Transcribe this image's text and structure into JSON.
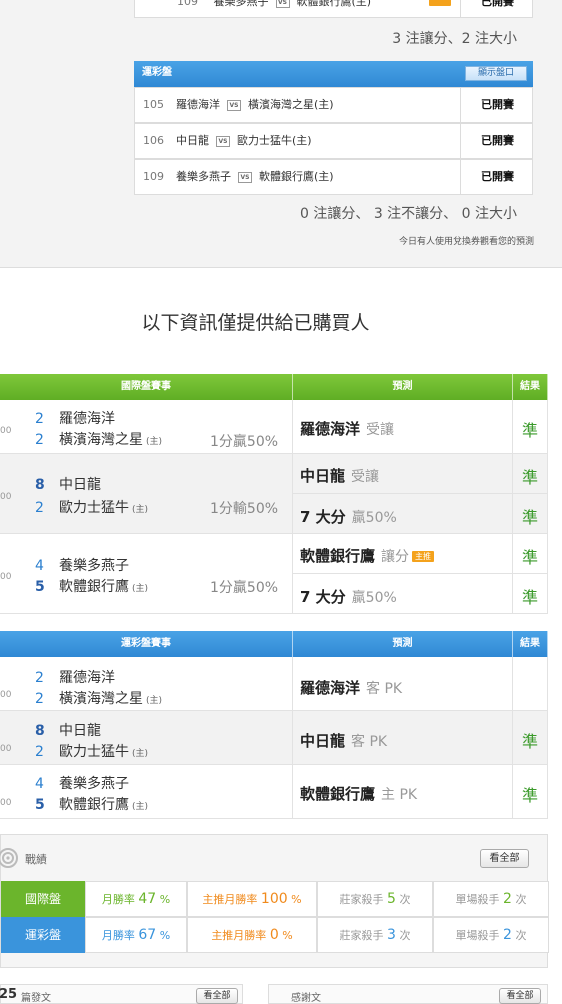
{
  "top_partial_row": {
    "no": "109",
    "home": "養樂多燕子",
    "away": "軟體銀行鷹(主)",
    "status": "已開賽"
  },
  "intl_summary": "3 注讓分、2 注大小",
  "lottery_box": {
    "title": "運彩盤",
    "button": "顯示盤口",
    "rows": [
      {
        "no": "105",
        "home": "羅德海洋",
        "vs": "VS",
        "away": "橫濱海灣之星(主)",
        "status": "已開賽"
      },
      {
        "no": "106",
        "home": "中日龍",
        "vs": "VS",
        "away": "歐力士猛牛(主)",
        "status": "已開賽"
      },
      {
        "no": "109",
        "home": "養樂多燕子",
        "vs": "VS",
        "away": "軟體銀行鷹(主)",
        "status": "已開賽"
      }
    ],
    "summary": "0 注讓分、 3 注不讓分、 0 注大小",
    "coupon_note": "今日有人使用兌換券觀看您的預測"
  },
  "buyers_notice": "以下資訊僅提供給已購買人",
  "intl_table": {
    "headers": {
      "match": "國際盤賽事",
      "pred": "預測",
      "result": "結果"
    },
    "games": [
      {
        "time": "00",
        "s1": "2",
        "t1": "羅德海洋",
        "s2": "2",
        "t2": "橫濱海灣之星",
        "host": "(主)",
        "line": "1分贏50%",
        "preds": [
          {
            "main": "羅德海洋",
            "sub": "受讓",
            "res": "準"
          }
        ]
      },
      {
        "time": "00",
        "s1": "8",
        "t1": "中日龍",
        "s2": "2",
        "t2": "歐力士猛牛",
        "host": "(主)",
        "line": "1分輸50%",
        "preds": [
          {
            "main": "中日龍",
            "sub": "受讓",
            "res": "準"
          },
          {
            "main": "7 大分",
            "sub": "贏50%",
            "res": "準"
          }
        ]
      },
      {
        "time": "00",
        "s1": "4",
        "t1": "養樂多燕子",
        "s2": "5",
        "t2": "軟體銀行鷹",
        "host": "(主)",
        "line": "1分贏50%",
        "preds": [
          {
            "main": "軟體銀行鷹",
            "sub": "讓分",
            "tag": "主推",
            "res": "準"
          },
          {
            "main": "7 大分",
            "sub": "贏50%",
            "res": "準"
          }
        ]
      }
    ]
  },
  "lottery_table": {
    "headers": {
      "match": "運彩盤賽事",
      "pred": "預測",
      "result": "結果"
    },
    "games": [
      {
        "time": "00",
        "s1": "2",
        "t1": "羅德海洋",
        "s2": "2",
        "t2": "橫濱海灣之星",
        "host": "(主)",
        "pred": "羅德海洋",
        "sub": "客 PK",
        "res": ""
      },
      {
        "time": "00",
        "s1": "8",
        "t1": "中日龍",
        "s2": "2",
        "t2": "歐力士猛牛",
        "host": "(主)",
        "pred": "中日龍",
        "sub": "客 PK",
        "res": "準"
      },
      {
        "time": "00",
        "s1": "4",
        "t1": "養樂多燕子",
        "s2": "5",
        "t2": "軟體銀行鷹",
        "host": "(主)",
        "pred": "軟體銀行鷹",
        "sub": "主 PK",
        "res": "準"
      }
    ]
  },
  "stats": {
    "title": "戰績",
    "view_all": "看全部",
    "rows": [
      {
        "label": "國際盤",
        "monthly_label": "月勝率",
        "monthly": "47",
        "monthly_unit": "%",
        "main_label": "主推月勝率",
        "main": "100",
        "main_unit": "%",
        "banker_label": "莊家殺手",
        "banker": "5",
        "banker_unit": "次",
        "single_label": "單場殺手",
        "single": "2",
        "single_unit": "次"
      },
      {
        "label": "運彩盤",
        "monthly_label": "月勝率",
        "monthly": "67",
        "monthly_unit": "%",
        "main_label": "主推月勝率",
        "main": "0",
        "main_unit": "%",
        "banker_label": "莊家殺手",
        "banker": "3",
        "banker_unit": "次",
        "single_label": "單場殺手",
        "single": "2",
        "single_unit": "次"
      }
    ]
  },
  "bottom": {
    "left_count": "25",
    "left_label": "篇發文",
    "left_btn": "看全部",
    "right_label": "感謝文",
    "right_btn": "看全部"
  },
  "colors": {
    "green": "#6bb52c",
    "blue": "#3a94dc",
    "win": "#3a9a2a",
    "orange": "#f08a1c"
  }
}
